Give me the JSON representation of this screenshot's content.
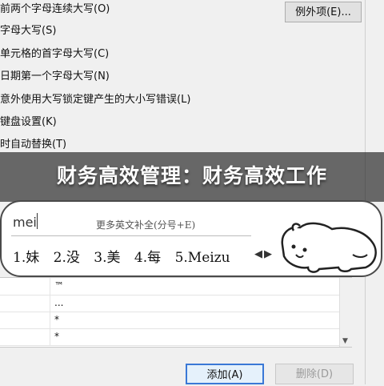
{
  "dialog": {
    "options": [
      "前两个字母连续大写(O)",
      "字母大写(S)",
      "单元格的首字母大写(C)",
      "日期第一个字母大写(N)",
      "意外使用大写锁定键产生的大小写错误(L)",
      "键盘设置(K)",
      "时自动替换(T)"
    ],
    "exceptions_button": "例外项(E)...",
    "add_button": "添加(A)",
    "delete_button": "删除(D)",
    "table_values": [
      "™",
      "...",
      "*",
      "*"
    ]
  },
  "banner": {
    "title": "财务高效管理：财务高效工作"
  },
  "ime": {
    "input": "mei",
    "hint": "更多英文补全(分号+E)",
    "candidates": [
      "1.妹",
      "2.没",
      "3.美",
      "4.每",
      "5.Meizu"
    ],
    "prev_icon": "triangle-left-icon",
    "next_icon": "triangle-right-icon"
  },
  "colors": {
    "banner_bg": "#141414",
    "primary_button_border": "#3a78d6"
  }
}
